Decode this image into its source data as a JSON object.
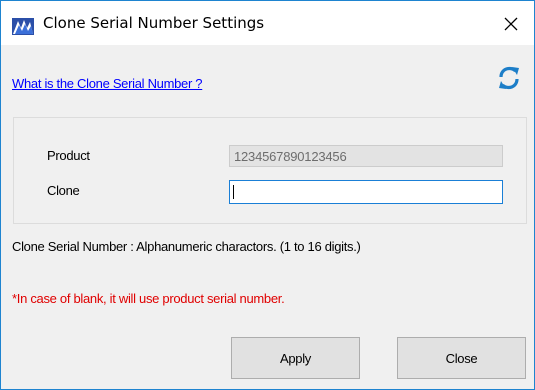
{
  "window": {
    "title": "Clone Serial Number Settings",
    "app_icon": "app-logo-icon",
    "close_icon": "close-icon"
  },
  "help": {
    "link_text": "What is the Clone Serial Number ?",
    "refresh_icon": "refresh-icon"
  },
  "form": {
    "product_label": "Product",
    "product_value": "1234567890123456",
    "clone_label": "Clone",
    "clone_value": ""
  },
  "info": {
    "rule_text": "Clone Serial Number : Alphanumeric charactors. (1 to 16 digits.)",
    "warning_text": "*In case of blank, it will use product serial number."
  },
  "buttons": {
    "apply_label": "Apply",
    "close_label": "Close"
  },
  "colors": {
    "link": "#0000ff",
    "warning": "#e00000",
    "focus_border": "#1a7fd6",
    "dialog_bg": "#f0f0f0"
  }
}
